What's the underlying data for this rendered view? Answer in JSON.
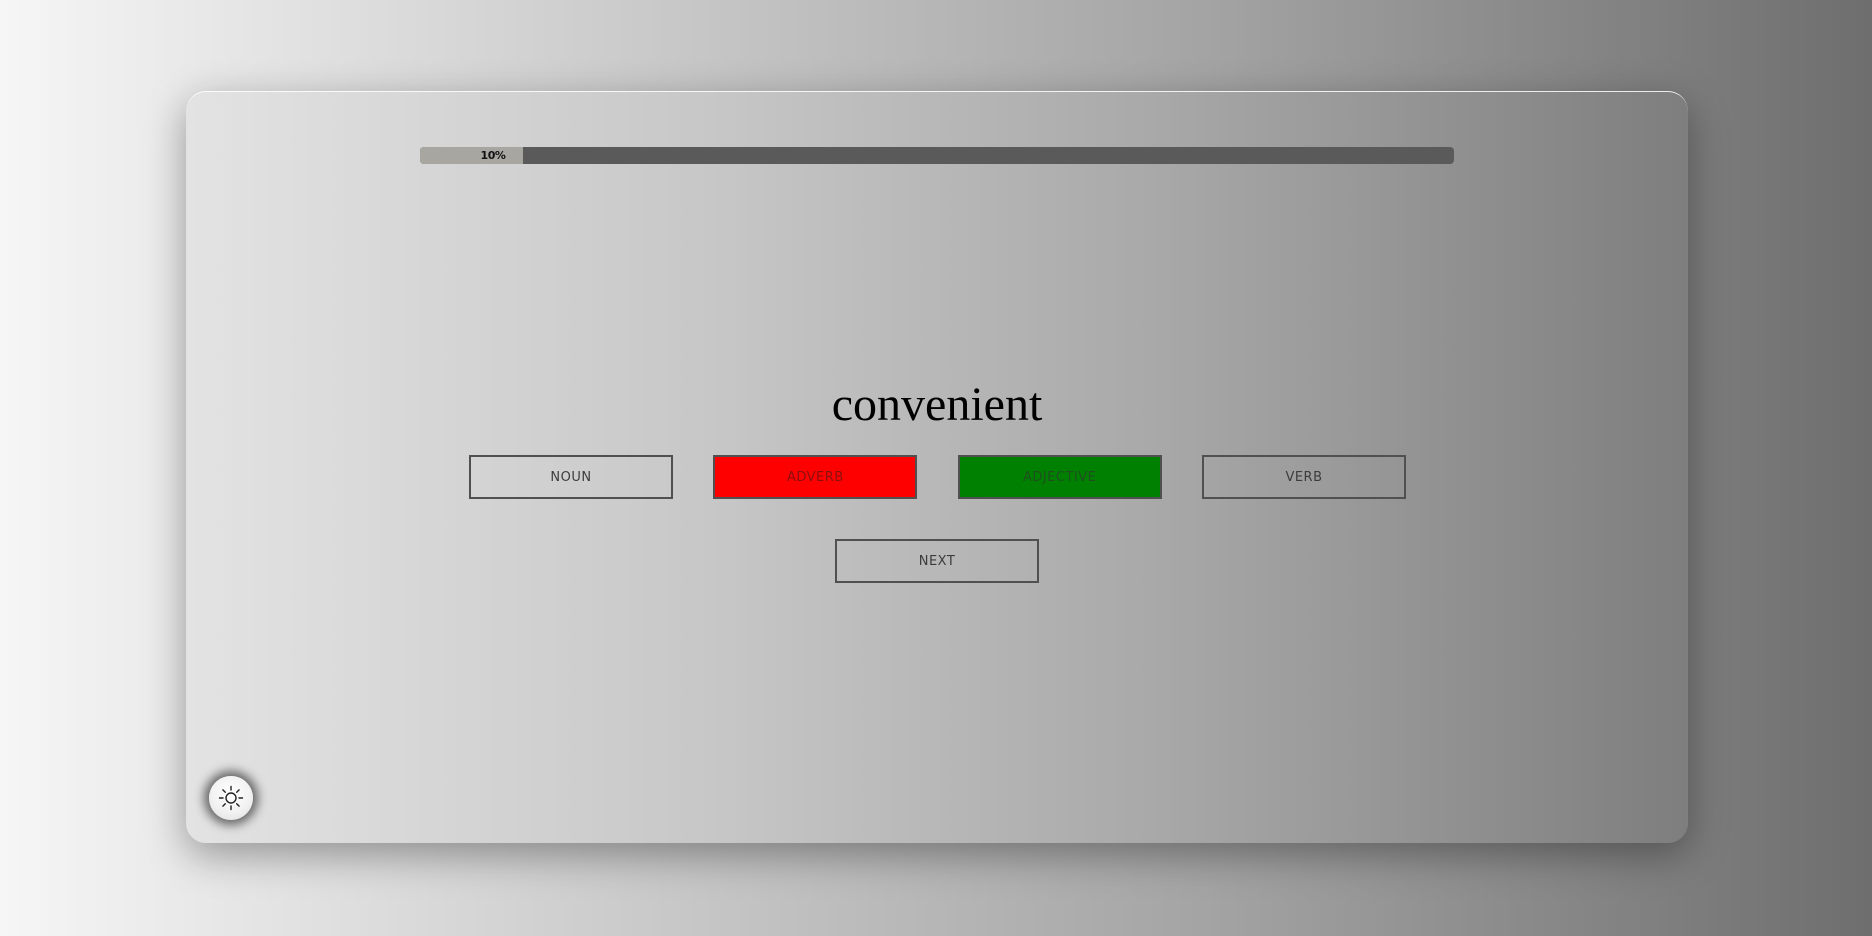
{
  "progress": {
    "percent": 10,
    "label": "10%"
  },
  "quiz": {
    "word": "convenient",
    "choices": [
      {
        "label": "NOUN",
        "state": "neutral"
      },
      {
        "label": "ADVERB",
        "state": "incorrect",
        "color": "#ff0000"
      },
      {
        "label": "ADJECTIVE",
        "state": "correct",
        "color": "#008000"
      },
      {
        "label": "VERB",
        "state": "neutral"
      }
    ],
    "next_label": "NEXT"
  },
  "theme_toggle": {
    "icon": "sun-icon"
  }
}
